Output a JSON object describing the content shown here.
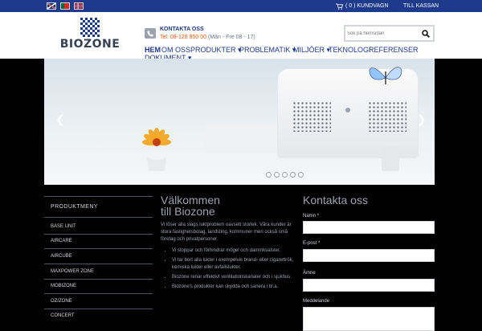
{
  "topbar": {
    "languages": [
      "English",
      "Português",
      "Norsk"
    ],
    "cart_label": "( 0 ) KUNDVAGN",
    "checkout_label": "TILL KASSAN"
  },
  "logo": {
    "text": "BIOZONE"
  },
  "contact": {
    "title": "KONTAKTA OSS",
    "phone": "Tel: 08-128 950 00",
    "hours": "(Mån - Fre 08 - 17)"
  },
  "search": {
    "placeholder": "Sök på hemsidan",
    "icon": "search-icon"
  },
  "nav": {
    "items": [
      "HEM",
      "OM OSS",
      "PRODUKTER ▾",
      "PROBLEMATIK ▾",
      "MILJÖER ▾",
      "TEKNOLOGI",
      "REFERENSER",
      "DOKUMENT ▾"
    ]
  },
  "slider": {
    "prev_icon": "chevron-left-icon",
    "next_icon": "chevron-right-icon",
    "slides": 5,
    "active_slide": 1
  },
  "sidebar": {
    "title": "PRODUKTMENY",
    "items": [
      "BASE UNIT",
      "AIRCARE",
      "AIRCUBE",
      "MAXPOWER ZONE",
      "MOBIZONE",
      "OZ/ZONE",
      "CONCERT"
    ]
  },
  "welcome": {
    "title_line1": "Välkommen",
    "title_line2": "till Biozone",
    "intro": "Vi löser alla slags luktproblem oavsett storlek. Våra kunder är stora fastighetsbolag, landsting, kommuner men också små företag och privatpersoner.",
    "bullets": [
      "Vi stoppar och förhindrar mögel och dammkvalster.",
      "Vi tar bort alla lukter i exempelvis brand- eller cigarettrök, kemiska lukter eller avfallslukter.",
      "Biozone renar effektivt ventilationskanaler och i sjukhus.",
      "Biozone's produkter kan skydda och sanera i bl.a."
    ]
  },
  "contact_form": {
    "title": "Kontakta oss",
    "fields": [
      "Namn *",
      "E-post *",
      "Ämne",
      "Meddelande"
    ]
  },
  "colors": {
    "brand_blue": "#1e3a8a",
    "phone_orange": "#ea580c",
    "background": "#000000"
  }
}
